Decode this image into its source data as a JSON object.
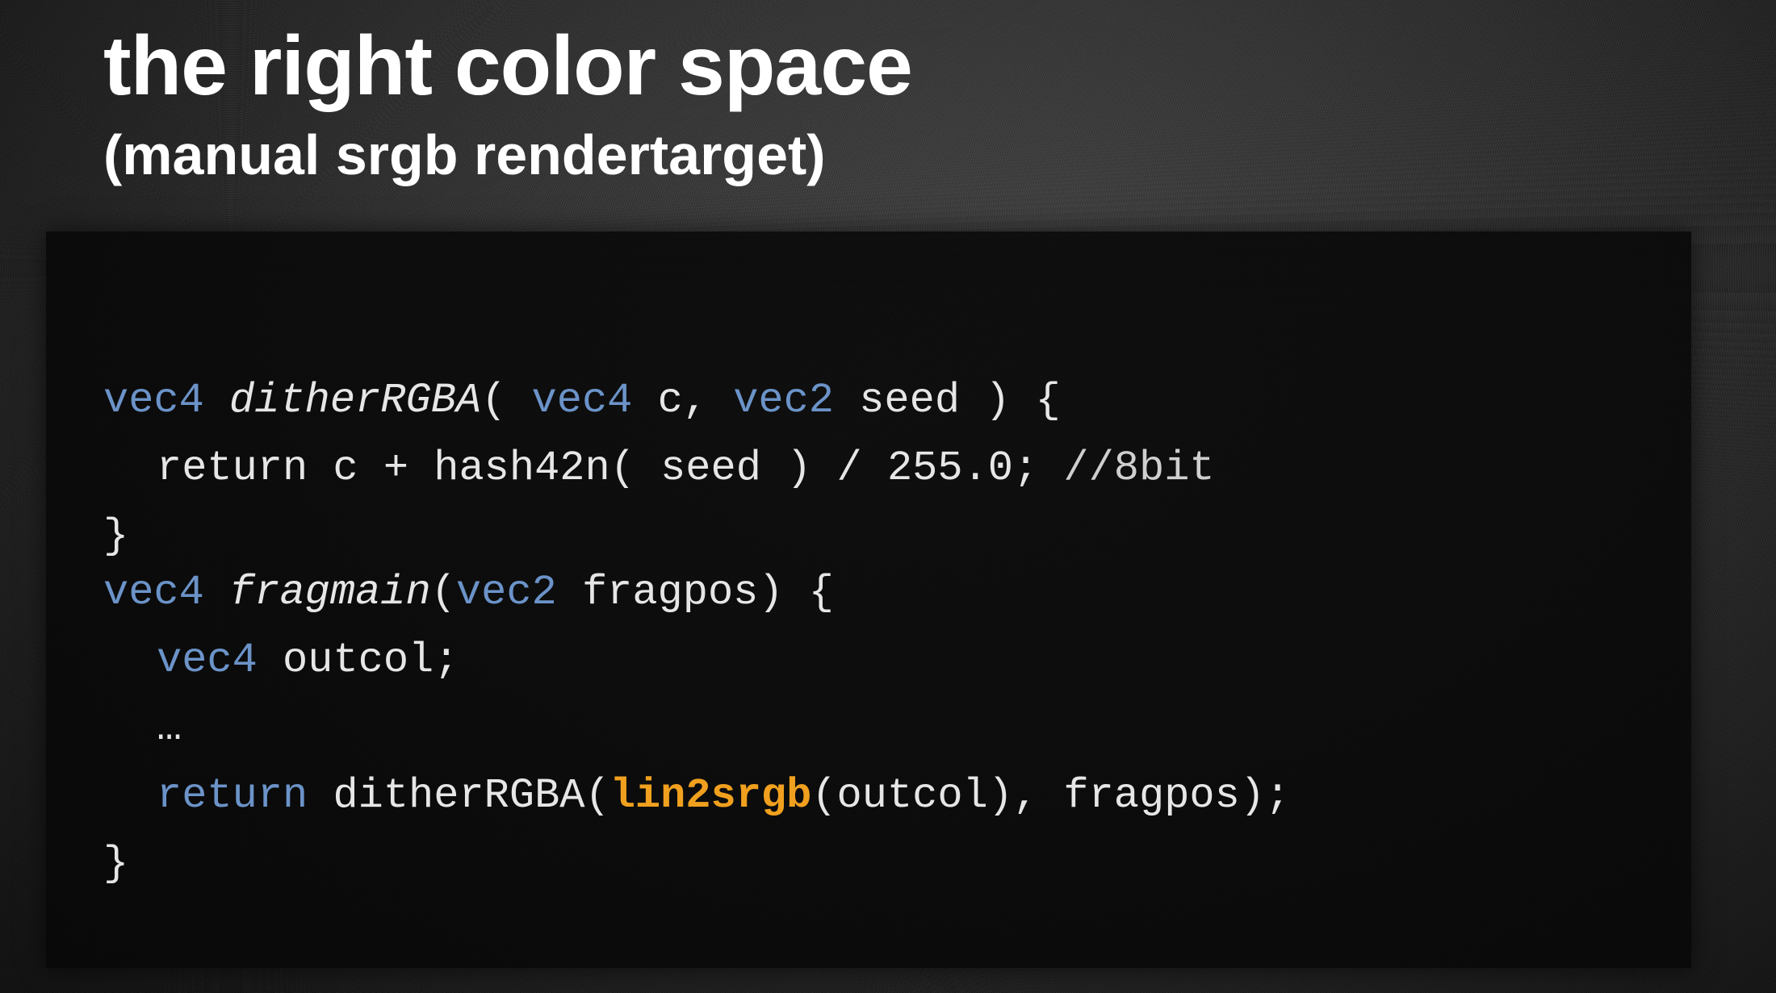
{
  "slide": {
    "title": "the right color space",
    "subtitle": "(manual srgb rendertarget)"
  },
  "colors": {
    "keyword": "#6b93c8",
    "highlight": "#f0a01e",
    "text": "#e6e6e6",
    "title": "#ffffff"
  },
  "code": {
    "l1_kw1": "vec4",
    "l1_fn": "ditherRGBA",
    "l1_p1": "( ",
    "l1_kw2": "vec4",
    "l1_p2": " c, ",
    "l1_kw3": "vec2",
    "l1_p3": " seed ) {",
    "l2_text": "return c + hash42n( seed ) / 255.0; ",
    "l2_comment": "//8bit",
    "l3_text": "}",
    "l4_kw1": "vec4",
    "l4_fn": "fragmain",
    "l4_p1": "(",
    "l4_kw2": "vec2",
    "l4_p2": " fragpos) {",
    "l5_kw": "vec4",
    "l5_text": " outcol;",
    "l6_text": "…",
    "l7_kw": "return",
    "l7_p1": " ditherRGBA(",
    "l7_hl": "lin2srgb",
    "l7_p2": "(outcol), fragpos);",
    "l8_text": "}"
  }
}
